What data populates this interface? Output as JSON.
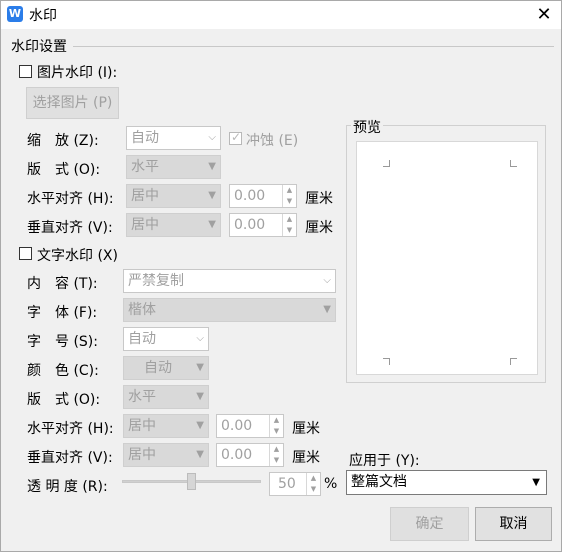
{
  "window": {
    "title": "水印",
    "close_glyph": "✕",
    "app_icon": "W"
  },
  "group_title": "水印设置",
  "picture_watermark": {
    "checkbox_label": "图片水印 (I):",
    "select_button": "选择图片 (P)",
    "scale_label": "缩　放 (Z):",
    "scale_value": "自动",
    "washout_label": "冲蚀 (E)",
    "layout_label": "版　式 (O):",
    "layout_value": "水平",
    "h_align_label": "水平对齐 (H):",
    "h_align_value": "居中",
    "h_offset": "0.00",
    "v_align_label": "垂直对齐 (V):",
    "v_align_value": "居中",
    "v_offset": "0.00",
    "unit": "厘米"
  },
  "text_watermark": {
    "checkbox_label": "文字水印 (X)",
    "content_label": "内　容 (T):",
    "content_value": "严禁复制",
    "font_label": "字　体 (F):",
    "font_value": "楷体",
    "size_label": "字　号 (S):",
    "size_value": "自动",
    "color_label": "颜　色 (C):",
    "color_value": "自动",
    "layout_label": "版　式 (O):",
    "layout_value": "水平",
    "h_align_label": "水平对齐 (H):",
    "h_align_value": "居中",
    "h_offset": "0.00",
    "v_align_label": "垂直对齐 (V):",
    "v_align_value": "居中",
    "v_offset": "0.00",
    "unit": "厘米",
    "transparency_label": "透 明 度 (R):",
    "transparency_value": "50",
    "transparency_unit": "%"
  },
  "preview": {
    "title": "预览"
  },
  "apply_to": {
    "label": "应用于 (Y):",
    "value": "整篇文档"
  },
  "buttons": {
    "ok": "确定",
    "cancel": "取消"
  },
  "colors": {
    "disabled_text": "#a0a0a0",
    "window_bg": "#f0f0f0",
    "title_icon": "#2b7de9"
  }
}
